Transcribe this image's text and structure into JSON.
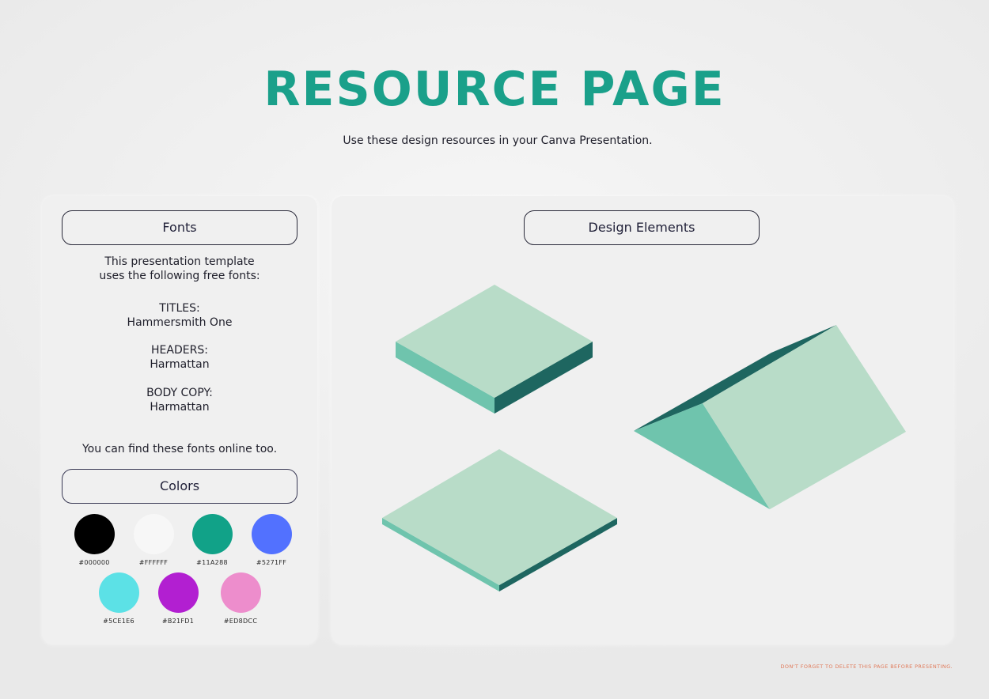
{
  "header": {
    "title": "RESOURCE PAGE",
    "subtitle": "Use these design resources in your Canva Presentation."
  },
  "fonts_section": {
    "heading": "Fonts",
    "intro_line1": "This presentation template",
    "intro_line2": "uses the following free fonts:",
    "entries": [
      {
        "label": "TITLES:",
        "font": "Hammersmith One"
      },
      {
        "label": "HEADERS:",
        "font": "Harmattan"
      },
      {
        "label": "BODY COPY:",
        "font": "Harmattan"
      }
    ],
    "note": "You can find these fonts online too."
  },
  "colors_section": {
    "heading": "Colors",
    "swatches": [
      {
        "hex": "#000000",
        "label": "#000000"
      },
      {
        "hex": "#F7F7F7",
        "label": "#FFFFFF"
      },
      {
        "hex": "#11A288",
        "label": "#11A288"
      },
      {
        "hex": "#5271FF",
        "label": "#5271FF"
      },
      {
        "hex": "#5CE1E6",
        "label": "#5CE1E6"
      },
      {
        "hex": "#B21FD1",
        "label": "#B21FD1"
      },
      {
        "hex": "#ED8DCC",
        "label": "#ED8DCC"
      }
    ]
  },
  "design_section": {
    "heading": "Design Elements",
    "shape_colors": {
      "top": "#b8dcc8",
      "side_light": "#6fc4ad",
      "side_dark": "#1e6660"
    },
    "shapes": [
      "thick-square-tile",
      "thin-square-tile",
      "triangular-prism"
    ]
  },
  "footer": {
    "note": "DON'T FORGET TO DELETE THIS PAGE BEFORE PRESENTING."
  }
}
